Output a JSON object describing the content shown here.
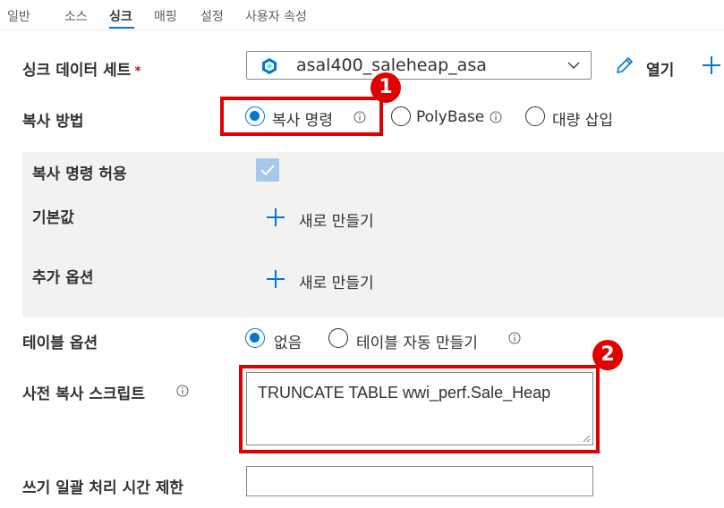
{
  "tabs": [
    {
      "label": "일반"
    },
    {
      "label": "소스"
    },
    {
      "label": "싱크"
    },
    {
      "label": "매핑"
    },
    {
      "label": "설정"
    },
    {
      "label": "사용자 속성"
    }
  ],
  "active_tab": "싱크",
  "sink_dataset": {
    "label": "싱크 데이터 세트",
    "required_mark": "*",
    "value": "asal400_saleheap_asa",
    "open_label": "열기"
  },
  "copy_method": {
    "label": "복사 방법",
    "options": [
      {
        "label": "복사 명령",
        "selected": true
      },
      {
        "label": "PolyBase",
        "selected": false
      },
      {
        "label": "대량 삽입",
        "selected": false
      }
    ]
  },
  "copy_command": {
    "allow_label": "복사 명령 허용",
    "allow_checked": true,
    "defaults_label": "기본값",
    "defaults_new": "새로 만들기",
    "extra_label": "추가 옵션",
    "extra_new": "새로 만들기"
  },
  "table_option": {
    "label": "테이블 옵션",
    "options": [
      {
        "label": "없음",
        "selected": true
      },
      {
        "label": "테이블 자동 만들기",
        "selected": false
      }
    ]
  },
  "pre_copy_script": {
    "label": "사전 복사 스크립트",
    "value": "TRUNCATE TABLE wwi_perf.Sale_Heap"
  },
  "write_batch_timeout": {
    "label": "쓰기 일괄 처리 시간 제한",
    "value": ""
  },
  "annotations": [
    {
      "number": "1"
    },
    {
      "number": "2"
    }
  ],
  "colors": {
    "accent": "#0078d4",
    "highlight": "#e00000",
    "panel": "#f3f2f1"
  }
}
